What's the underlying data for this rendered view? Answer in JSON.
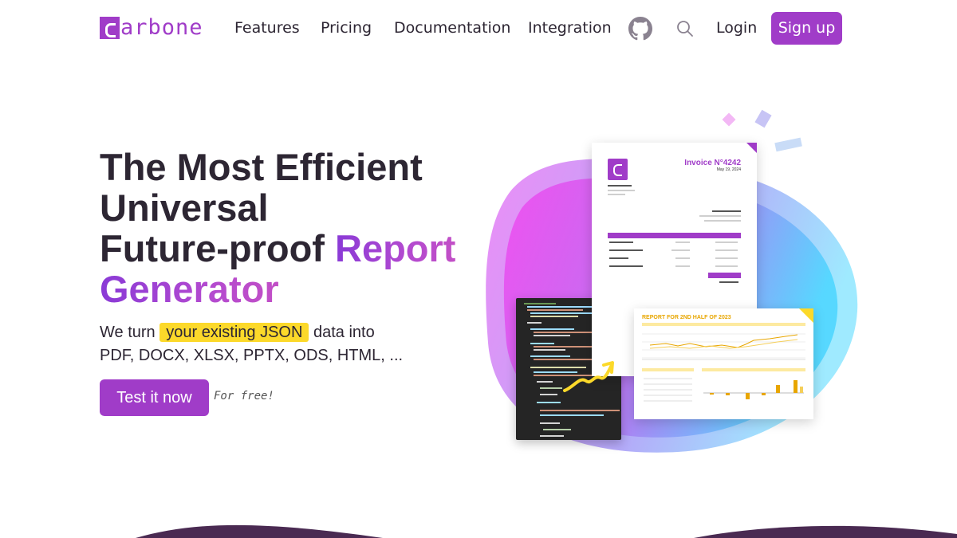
{
  "brand": {
    "name": "arbone",
    "color": "#a03cc8"
  },
  "nav": {
    "links": [
      "Features",
      "Pricing",
      "Documentation",
      "Integration"
    ],
    "github_icon": "github-icon",
    "search_icon": "search-icon",
    "login": "Login",
    "signup": "Sign up"
  },
  "hero": {
    "title_line1": "The Most Efficient",
    "title_line2": "Universal",
    "title_line3_plain": "Future-proof ",
    "title_line3_accent": "Report",
    "title_line4_accent": "Generator",
    "subtitle_before": "We turn",
    "subtitle_highlight": "your existing JSON",
    "subtitle_after": "data into",
    "subtitle_line2": "PDF, DOCX, XLSX, PPTX, ODS, HTML, ...",
    "cta": "Test it now",
    "cta_note": "For free!"
  },
  "illustration": {
    "invoice_title": "Invoice N°4242",
    "invoice_date": "May 19, 2024",
    "report_title": "REPORT FOR 2ND HALF OF 2023"
  },
  "colors": {
    "accent": "#a03cc8",
    "highlight": "#fcd92a",
    "text": "#2d2633"
  }
}
